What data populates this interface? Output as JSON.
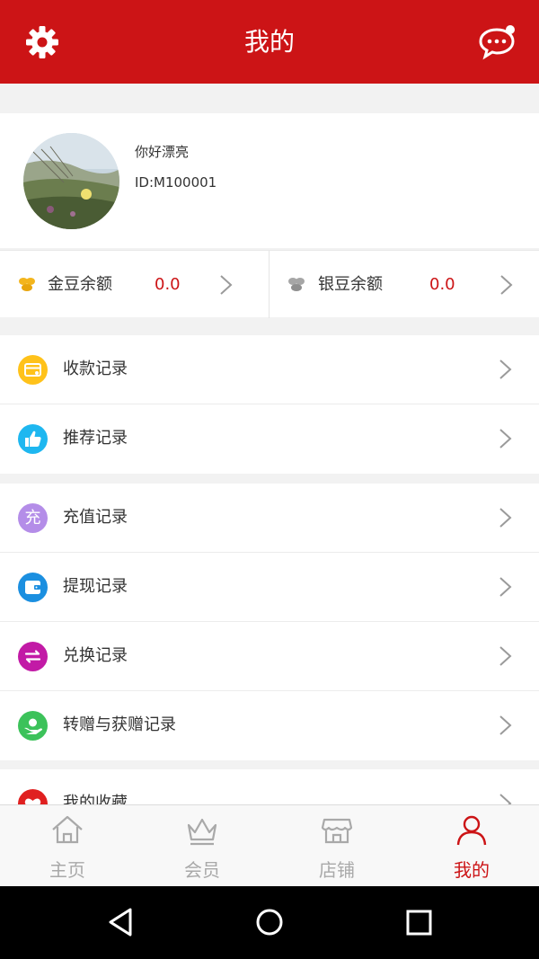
{
  "header": {
    "title": "我的",
    "settings_icon": "gear-icon",
    "message_icon": "chat-bubble-icon"
  },
  "profile": {
    "greeting": "你好漂亮",
    "user_id": "ID:M100001"
  },
  "balances": {
    "gold": {
      "label": "金豆余额",
      "value": "0.0",
      "icon": "gold-beans-icon"
    },
    "silver": {
      "label": "银豆余额",
      "value": "0.0",
      "icon": "silver-beans-icon"
    }
  },
  "menu_group_1": [
    {
      "label": "收款记录",
      "icon": "card-icon",
      "color": "#ffc21a"
    },
    {
      "label": "推荐记录",
      "icon": "thumbs-up-icon",
      "color": "#1eb7f0"
    }
  ],
  "menu_group_2": [
    {
      "label": "充值记录",
      "icon": "recharge-icon",
      "icon_text": "充",
      "color": "#b48de8"
    },
    {
      "label": "提现记录",
      "icon": "wallet-icon",
      "color": "#1b8fe0"
    },
    {
      "label": "兑换记录",
      "icon": "exchange-icon",
      "color": "#c21aa6"
    },
    {
      "label": "转赠与获赠记录",
      "icon": "gift-icon",
      "color": "#3cc25a"
    }
  ],
  "menu_group_3": [
    {
      "label": "我的收藏",
      "icon": "heart-icon",
      "color": "#e02020"
    }
  ],
  "tabbar": [
    {
      "label": "主页",
      "icon": "home-icon",
      "active": false
    },
    {
      "label": "会员",
      "icon": "crown-icon",
      "active": false
    },
    {
      "label": "店铺",
      "icon": "shop-icon",
      "active": false
    },
    {
      "label": "我的",
      "icon": "user-icon",
      "active": true
    }
  ],
  "colors": {
    "brand": "#cc1416",
    "inactive_tab": "#a9a9a9"
  }
}
